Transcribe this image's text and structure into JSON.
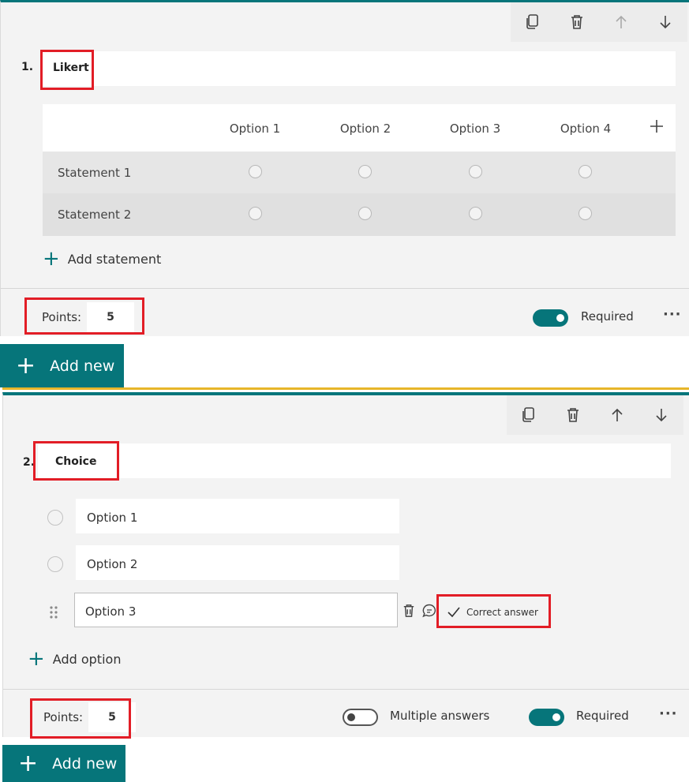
{
  "q1": {
    "number": "1.",
    "title": "Likert",
    "columns": [
      "Option 1",
      "Option 2",
      "Option 3",
      "Option 4"
    ],
    "statements": [
      "Statement 1",
      "Statement 2"
    ],
    "add_statement": "Add statement",
    "points_label": "Points:",
    "points_value": "5",
    "required_label": "Required",
    "required_on": true,
    "more": "···"
  },
  "add_new_1": {
    "label": "Add new"
  },
  "q2": {
    "number": "2.",
    "title": "Choice",
    "options": [
      "Option 1",
      "Option 2",
      "Option 3"
    ],
    "correct_answer": "Correct answer",
    "add_option": "Add option",
    "points_label": "Points:",
    "points_value": "5",
    "multiple_answers_label": "Multiple answers",
    "multiple_answers_on": false,
    "required_label": "Required",
    "required_on": true,
    "more": "···"
  },
  "add_new_2": {
    "label": "Add new"
  },
  "icons": {
    "toolbar": [
      "copy-icon",
      "trash-icon",
      "arrow-up-icon",
      "arrow-down-icon"
    ],
    "add": "plus-icon",
    "drag": "drag-handle-icon",
    "feedback": "comment-icon",
    "check": "checkmark-icon"
  },
  "colors": {
    "accent": "#06757a",
    "highlight": "#e21d26",
    "divider": "#e7b62a"
  }
}
